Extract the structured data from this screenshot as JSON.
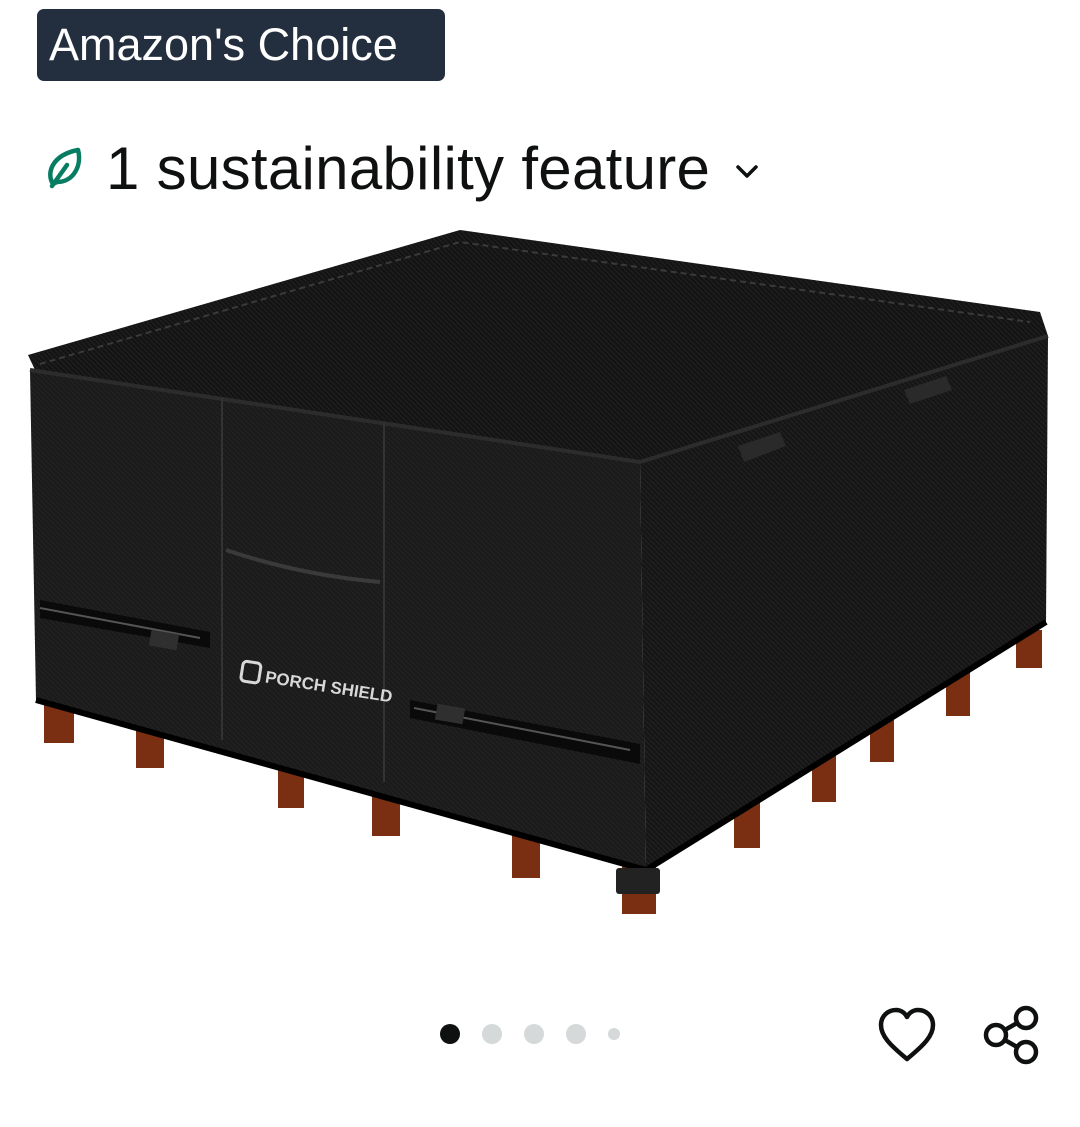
{
  "badge": {
    "label": "Amazon's Choice",
    "background": "#232f3e"
  },
  "sustainability": {
    "label": "1 sustainability feature",
    "icon": "leaf-icon",
    "icon_color": "#067d62",
    "toggle_icon": "chevron-down-icon"
  },
  "product_image": {
    "brand_label": "PORCH SHIELD"
  },
  "carousel": {
    "total_images": 5,
    "active_index": 0
  },
  "actions": {
    "wishlist_icon": "heart-icon",
    "share_icon": "share-icon"
  }
}
